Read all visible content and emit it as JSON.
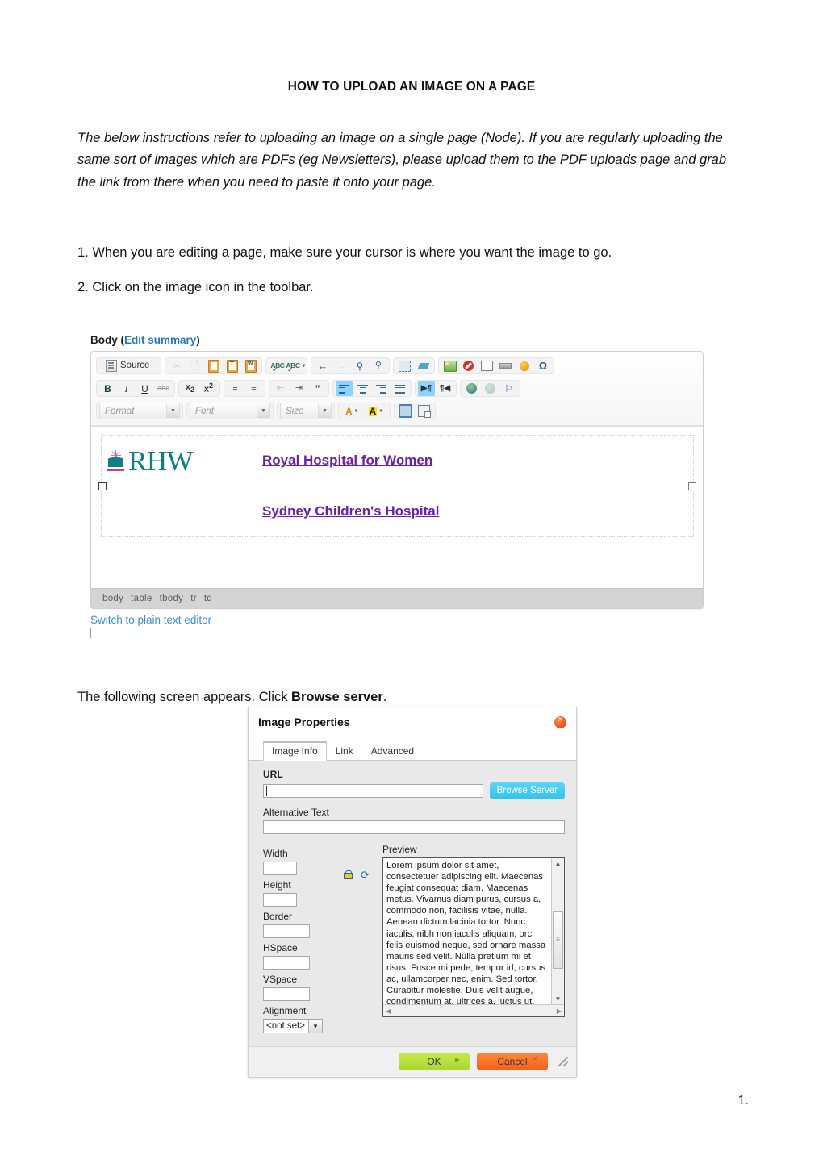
{
  "document": {
    "title": "HOW TO UPLOAD AN IMAGE ON A PAGE",
    "intro": "The below instructions refer to uploading an image on a single page (Node). If you are regularly uploading the same sort of images which are PDFs (eg Newsletters), please upload them to the PDF uploads page and grab the link from there when you need to paste it onto your page.",
    "step_1": "1. When you are editing a page, make sure your cursor is where you want the image to go.",
    "step_2": "2. Click on the image icon in the toolbar.",
    "follow_prefix": "The following screen appears. Click ",
    "follow_bold": "Browse server",
    "follow_suffix": ".",
    "page_number": "1."
  },
  "editor": {
    "body_label_plain": "Body (",
    "body_label_link": "Edit summary",
    "body_label_close": ")",
    "source_button": "Source",
    "toolbar_rows": [
      {
        "groups": [
          {
            "buttons": [
              {
                "name": "source-button",
                "label": "Source"
              }
            ]
          },
          {
            "buttons": [
              {
                "name": "cut-icon",
                "label": ""
              },
              {
                "name": "copy-icon",
                "label": ""
              },
              {
                "name": "paste-icon",
                "label": ""
              },
              {
                "name": "paste-as-plain-text-icon",
                "label": ""
              },
              {
                "name": "paste-from-word-icon",
                "label": ""
              }
            ]
          },
          {
            "buttons": [
              {
                "name": "spell-check-icon",
                "label": ""
              },
              {
                "name": "spell-check-as-you-type-icon",
                "label": ""
              }
            ]
          },
          {
            "buttons": [
              {
                "name": "undo-icon",
                "label": ""
              },
              {
                "name": "redo-icon",
                "label": ""
              },
              {
                "name": "find-icon",
                "label": ""
              },
              {
                "name": "replace-icon",
                "label": ""
              }
            ]
          },
          {
            "buttons": [
              {
                "name": "select-all-icon",
                "label": ""
              },
              {
                "name": "remove-format-icon",
                "label": ""
              }
            ]
          },
          {
            "buttons": [
              {
                "name": "image-icon",
                "label": ""
              },
              {
                "name": "flash-icon",
                "label": ""
              },
              {
                "name": "table-icon",
                "label": ""
              },
              {
                "name": "horizontal-rule-icon",
                "label": ""
              },
              {
                "name": "smiley-icon",
                "label": ""
              },
              {
                "name": "special-character-icon",
                "label": ""
              }
            ]
          }
        ]
      },
      {
        "groups": [
          {
            "buttons": [
              {
                "name": "bold-icon",
                "label": "B"
              },
              {
                "name": "italic-icon",
                "label": "I"
              },
              {
                "name": "underline-icon",
                "label": "U"
              },
              {
                "name": "strikethrough-icon",
                "label": "abc"
              }
            ]
          },
          {
            "buttons": [
              {
                "name": "subscript-icon",
                "label": "x"
              },
              {
                "name": "superscript-icon",
                "label": "x"
              }
            ]
          },
          {
            "buttons": [
              {
                "name": "numbered-list-icon",
                "label": ""
              },
              {
                "name": "bulleted-list-icon",
                "label": ""
              }
            ]
          },
          {
            "buttons": [
              {
                "name": "decrease-indent-icon",
                "label": ""
              },
              {
                "name": "increase-indent-icon",
                "label": ""
              },
              {
                "name": "block-quote-icon",
                "label": ""
              }
            ]
          },
          {
            "buttons": [
              {
                "name": "align-left-icon",
                "label": ""
              },
              {
                "name": "align-center-icon",
                "label": ""
              },
              {
                "name": "align-right-icon",
                "label": ""
              },
              {
                "name": "align-justify-icon",
                "label": ""
              }
            ]
          },
          {
            "buttons": [
              {
                "name": "text-direction-ltr-icon",
                "label": ""
              },
              {
                "name": "text-direction-rtl-icon",
                "label": ""
              }
            ]
          },
          {
            "buttons": [
              {
                "name": "link-icon",
                "label": ""
              },
              {
                "name": "unlink-icon",
                "label": ""
              },
              {
                "name": "anchor-icon",
                "label": ""
              }
            ]
          }
        ]
      }
    ],
    "format_combo": "Format",
    "font_combo": "Font",
    "size_combo": "Size",
    "text_color_label": "A",
    "bg_color_label": "A",
    "content": {
      "logo_text": "RHW",
      "row_1_link": "Royal Hospital for Women",
      "row_2_link": "Sydney Children's Hospital"
    },
    "elements_path": [
      "body",
      "table",
      "tbody",
      "tr",
      "td"
    ],
    "switch_link": "Switch to plain text editor"
  },
  "dialog": {
    "title": "Image Properties",
    "close_label": "close",
    "tabs": [
      {
        "label": "Image Info",
        "active": true
      },
      {
        "label": "Link",
        "active": false
      },
      {
        "label": "Advanced",
        "active": false
      }
    ],
    "url_label": "URL",
    "url_value": "",
    "browse_button": "Browse Server",
    "alt_label": "Alternative Text",
    "alt_value": "",
    "width_label": "Width",
    "width_value": "",
    "height_label": "Height",
    "height_value": "",
    "border_label": "Border",
    "border_value": "",
    "hspace_label": "HSpace",
    "hspace_value": "",
    "vspace_label": "VSpace",
    "vspace_value": "",
    "alignment_label": "Alignment",
    "alignment_value": "<not set>",
    "preview_label": "Preview",
    "preview_text": "Lorem ipsum dolor sit amet, consectetuer adipiscing elit. Maecenas feugiat consequat diam. Maecenas metus. Vivamus diam purus, cursus a, commodo non, facilisis vitae, nulla. Aenean dictum lacinia tortor. Nunc iaculis, nibh non iaculis aliquam, orci felis euismod neque, sed ornare massa mauris sed velit. Nulla pretium mi et risus. Fusce mi pede, tempor id, cursus ac, ullamcorper nec, enim. Sed tortor. Curabitur molestie. Duis velit augue, condimentum at, ultrices a, luctus ut, orci. Donec pellentesque egestas eros. Integer cursus, augue in cursus faucibus, eros pede bibendum",
    "ok_button": "OK",
    "cancel_button": "Cancel"
  },
  "colors": {
    "link_blue": "#3b8ede",
    "heading_purple": "#6a1fad",
    "logo_teal": "#0d8087",
    "logo_pink": "#d9357a",
    "browse_cyan": "#2ec4ec",
    "ok_green": "#a8d830",
    "cancel_orange": "#f4601a",
    "close_red": "#e03a10"
  }
}
